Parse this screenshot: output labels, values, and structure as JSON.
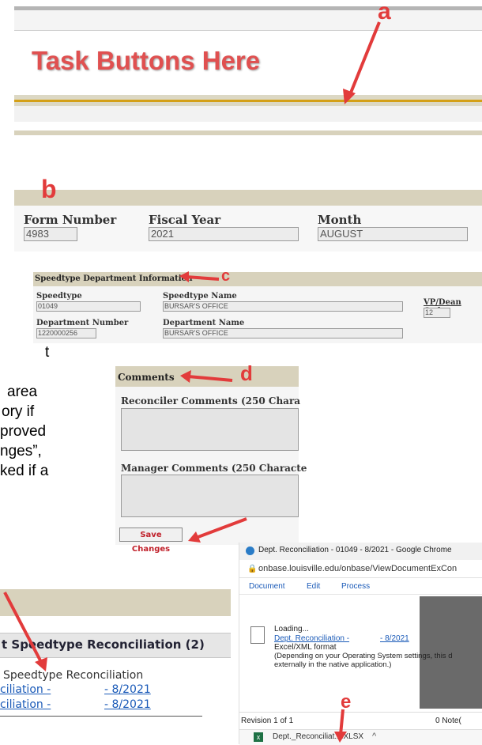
{
  "panel_a": {
    "title": "Task Buttons Here",
    "callout": "a"
  },
  "panel_b": {
    "callout": "b",
    "form_number_label": "Form Number",
    "form_number_value": "4983",
    "fiscal_year_label": "Fiscal Year",
    "fiscal_year_value": "2021",
    "month_label": "Month",
    "month_value": "AUGUST"
  },
  "panel_c": {
    "callout": "c",
    "header": "Speedtype Department Information",
    "speedtype_label": "Speedtype",
    "speedtype_value": "01049",
    "speedtype_name_label": "Speedtype Name",
    "speedtype_name_value": "BURSAR'S OFFICE",
    "vp_dean_label": "VP/Dean Code",
    "vp_dean_value": "12",
    "dept_number_label": "Department Number",
    "dept_number_value": "1220000256",
    "dept_name_label": "Department Name",
    "dept_name_value": "BURSAR'S OFFICE"
  },
  "panel_d": {
    "callout": "d",
    "header": "Comments",
    "reconciler_label": "Reconciler Comments (250 Chara",
    "manager_label": "Manager Comments (250 Characte",
    "save_button": "Save Changes"
  },
  "left_text": [
    "t",
    "area",
    "ory if",
    "proved",
    "nges”,",
    "ked if a"
  ],
  "panel_list": {
    "header": "t Speedtype Reconciliation (2)",
    "col_header": "Speedtype Reconciliation",
    "rows": [
      {
        "name": "ciliation -",
        "date": "- 8/2021"
      },
      {
        "name": "ciliation -",
        "date": "- 8/2021"
      }
    ]
  },
  "panel_e": {
    "callout": "e",
    "window_title": "Dept. Reconciliation - 01049 - 8/2021 - Google Chrome",
    "url": "onbase.louisville.edu/onbase/ViewDocumentExCon",
    "menu": [
      "Document",
      "Edit",
      "Process"
    ],
    "loading": "Loading...",
    "doc_link": "Dept. Reconciliation -",
    "doc_date": "- 8/2021",
    "format": "Excel/XML format",
    "note1": "(Depending on your Operating System settings, this d",
    "note2": "externally in the native application.)",
    "revision": "Revision 1 of 1",
    "notes": "0 Note(",
    "download_name": "Dept._Reconciliat....XLSX",
    "download_chevron": "^"
  },
  "colors": {
    "accent_red": "#e23b3b",
    "bar_tan": "#d8d2bc",
    "gold_line": "#d4a017"
  }
}
